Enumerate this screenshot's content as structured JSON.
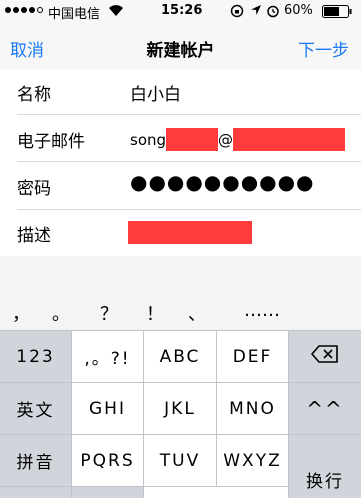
{
  "status_bar": {
    "carrier": "中国电信",
    "time": "15:26",
    "battery": "60%"
  },
  "nav": {
    "cancel": "取消",
    "title": "新建帐户",
    "next": "下一步"
  },
  "form": {
    "name_label": "名称",
    "name_value": "白小白",
    "email_label": "电子邮件",
    "email_prefix": "song",
    "email_at": "@",
    "password_label": "密码",
    "password_value": "●●●●●●●●●●",
    "description_label": "描述"
  },
  "candidates": [
    "，",
    "。",
    "？",
    "！",
    "、",
    "……"
  ],
  "keyboard": {
    "num_key": "123",
    "punct_key": ",。?!",
    "abc": "ABC",
    "def": "DEF",
    "backspace_icon": "⌫",
    "lang_key": "英文",
    "ghi": "GHI",
    "jkl": "JKL",
    "mno": "MNO",
    "emoji_key": "^^",
    "pinyin_key": "拼音",
    "pqrs": "PQRS",
    "tuv": "TUV",
    "wxyz": "WXYZ",
    "return_key": "换行"
  },
  "colors": {
    "accent": "#1a7bf5",
    "redaction": "#ff3b3b",
    "keyboard_bg": "#bfc3ca"
  }
}
